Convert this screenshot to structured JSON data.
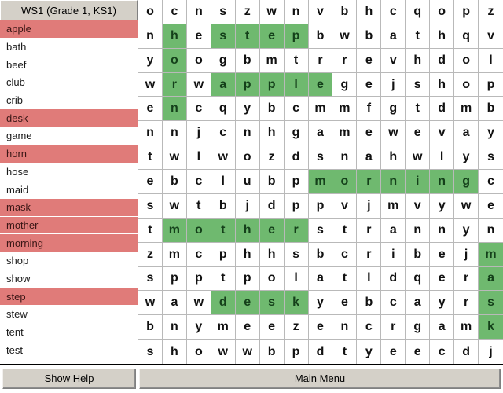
{
  "window": {
    "title": "WS1 (Grade 1, KS1)"
  },
  "sidebar": {
    "header_label": "WS1 (Grade 1, KS1)",
    "words": [
      {
        "label": "apple",
        "found": true
      },
      {
        "label": "bath",
        "found": false
      },
      {
        "label": "beef",
        "found": false
      },
      {
        "label": "club",
        "found": false
      },
      {
        "label": "crib",
        "found": false
      },
      {
        "label": "desk",
        "found": true
      },
      {
        "label": "game",
        "found": false
      },
      {
        "label": "horn",
        "found": true
      },
      {
        "label": "hose",
        "found": false
      },
      {
        "label": "maid",
        "found": false
      },
      {
        "label": "mask",
        "found": true
      },
      {
        "label": "mother",
        "found": true
      },
      {
        "label": "morning",
        "found": true
      },
      {
        "label": "shop",
        "found": false
      },
      {
        "label": "show",
        "found": false
      },
      {
        "label": "step",
        "found": true
      },
      {
        "label": "stew",
        "found": false
      },
      {
        "label": "tent",
        "found": false
      },
      {
        "label": "test",
        "found": false
      }
    ]
  },
  "grid": {
    "columns": 16,
    "rows": 16,
    "letters": [
      [
        "o",
        "c",
        "n",
        "s",
        "z",
        "w",
        "n",
        "v",
        "b",
        "h",
        "c",
        "q",
        "o",
        "p",
        "z"
      ],
      [
        "n",
        "h",
        "e",
        "s",
        "t",
        "e",
        "p",
        "b",
        "w",
        "b",
        "a",
        "t",
        "h",
        "q",
        "v"
      ],
      [
        "y",
        "o",
        "o",
        "g",
        "b",
        "m",
        "t",
        "r",
        "r",
        "e",
        "v",
        "h",
        "d",
        "o",
        "l"
      ],
      [
        "w",
        "r",
        "w",
        "a",
        "p",
        "p",
        "l",
        "e",
        "g",
        "e",
        "j",
        "s",
        "h",
        "o",
        "p"
      ],
      [
        "e",
        "n",
        "c",
        "q",
        "y",
        "b",
        "c",
        "m",
        "m",
        "f",
        "g",
        "t",
        "d",
        "m",
        "b"
      ],
      [
        "n",
        "n",
        "j",
        "c",
        "n",
        "h",
        "g",
        "a",
        "m",
        "e",
        "w",
        "e",
        "v",
        "a",
        "y"
      ],
      [
        "t",
        "w",
        "l",
        "w",
        "o",
        "z",
        "d",
        "s",
        "n",
        "a",
        "h",
        "w",
        "l",
        "y",
        "s"
      ],
      [
        "e",
        "b",
        "c",
        "l",
        "u",
        "b",
        "p",
        "m",
        "o",
        "r",
        "n",
        "i",
        "n",
        "g",
        "c"
      ],
      [
        "s",
        "w",
        "t",
        "b",
        "j",
        "d",
        "p",
        "p",
        "v",
        "j",
        "m",
        "v",
        "y",
        "w",
        "e"
      ],
      [
        "t",
        "m",
        "o",
        "t",
        "h",
        "e",
        "r",
        "s",
        "t",
        "r",
        "a",
        "n",
        "n",
        "y",
        "n"
      ],
      [
        "z",
        "m",
        "c",
        "p",
        "h",
        "h",
        "s",
        "b",
        "c",
        "r",
        "i",
        "b",
        "e",
        "j",
        "m"
      ],
      [
        "s",
        "p",
        "p",
        "t",
        "p",
        "o",
        "l",
        "a",
        "t",
        "l",
        "d",
        "q",
        "e",
        "r",
        "a"
      ],
      [
        "w",
        "a",
        "w",
        "d",
        "e",
        "s",
        "k",
        "y",
        "e",
        "b",
        "c",
        "a",
        "y",
        "r",
        "s"
      ],
      [
        "b",
        "n",
        "y",
        "m",
        "e",
        "e",
        "z",
        "e",
        "n",
        "c",
        "r",
        "g",
        "a",
        "m",
        "k"
      ],
      [
        "s",
        "h",
        "o",
        "w",
        "w",
        "b",
        "p",
        "d",
        "t",
        "y",
        "e",
        "e",
        "c",
        "d",
        "j"
      ]
    ],
    "highlights": [
      [
        0,
        0,
        0,
        0,
        0,
        0,
        0,
        0,
        0,
        0,
        0,
        0,
        0,
        0,
        0
      ],
      [
        0,
        1,
        0,
        1,
        1,
        1,
        1,
        0,
        0,
        0,
        0,
        0,
        0,
        0,
        0
      ],
      [
        0,
        1,
        0,
        0,
        0,
        0,
        0,
        0,
        0,
        0,
        0,
        0,
        0,
        0,
        0
      ],
      [
        0,
        1,
        0,
        1,
        1,
        1,
        1,
        1,
        0,
        0,
        0,
        0,
        0,
        0,
        0
      ],
      [
        0,
        1,
        0,
        0,
        0,
        0,
        0,
        0,
        0,
        0,
        0,
        0,
        0,
        0,
        0
      ],
      [
        0,
        0,
        0,
        0,
        0,
        0,
        0,
        0,
        0,
        0,
        0,
        0,
        0,
        0,
        0
      ],
      [
        0,
        0,
        0,
        0,
        0,
        0,
        0,
        0,
        0,
        0,
        0,
        0,
        0,
        0,
        0
      ],
      [
        0,
        0,
        0,
        0,
        0,
        0,
        0,
        1,
        1,
        1,
        1,
        1,
        1,
        1,
        0
      ],
      [
        0,
        0,
        0,
        0,
        0,
        0,
        0,
        0,
        0,
        0,
        0,
        0,
        0,
        0,
        0
      ],
      [
        0,
        1,
        1,
        1,
        1,
        1,
        1,
        0,
        0,
        0,
        0,
        0,
        0,
        0,
        0
      ],
      [
        0,
        0,
        0,
        0,
        0,
        0,
        0,
        0,
        0,
        0,
        0,
        0,
        0,
        0,
        1
      ],
      [
        0,
        0,
        0,
        0,
        0,
        0,
        0,
        0,
        0,
        0,
        0,
        0,
        0,
        0,
        1
      ],
      [
        0,
        0,
        0,
        1,
        1,
        1,
        1,
        0,
        0,
        0,
        0,
        0,
        0,
        0,
        1
      ],
      [
        0,
        0,
        0,
        0,
        0,
        0,
        0,
        0,
        0,
        0,
        0,
        0,
        0,
        0,
        1
      ],
      [
        0,
        0,
        0,
        0,
        0,
        0,
        0,
        0,
        0,
        0,
        0,
        0,
        0,
        0,
        0
      ]
    ]
  },
  "footer": {
    "show_help_label": "Show Help",
    "main_menu_label": "Main Menu"
  },
  "colors": {
    "found_word_red": "#e07b79",
    "highlight_green": "#6fb96f",
    "chrome_gray": "#d4d0c8",
    "grid_line": "#b9b9b9"
  }
}
